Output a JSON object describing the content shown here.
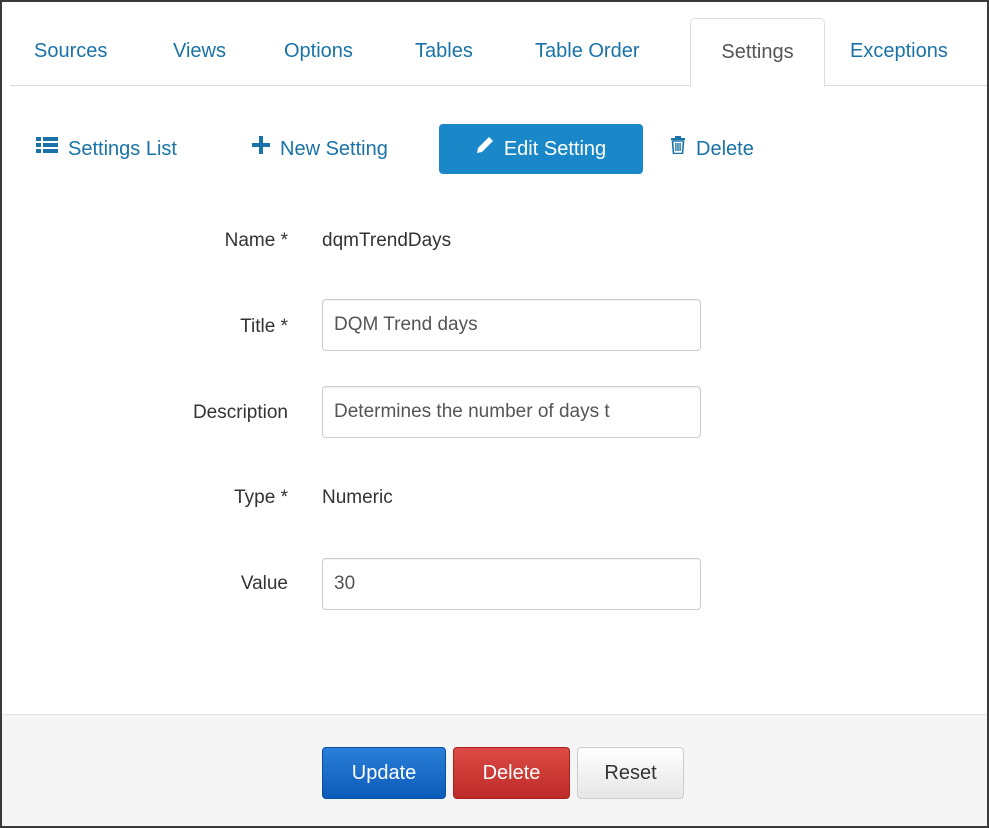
{
  "tabs": [
    {
      "label": "Sources"
    },
    {
      "label": "Views"
    },
    {
      "label": "Options"
    },
    {
      "label": "Tables"
    },
    {
      "label": "Table Order"
    },
    {
      "label": "Settings"
    },
    {
      "label": "Exceptions"
    }
  ],
  "active_tab": "Settings",
  "toolbar": {
    "settings_list": {
      "label": "Settings List",
      "icon": "list-icon"
    },
    "new_setting": {
      "label": "New Setting",
      "icon": "plus-icon"
    },
    "edit_setting": {
      "label": "Edit Setting",
      "icon": "pencil-icon"
    },
    "delete": {
      "label": "Delete",
      "icon": "trash-icon"
    }
  },
  "form": {
    "name": {
      "label": "Name *",
      "value": "dqmTrendDays"
    },
    "title": {
      "label": "Title *",
      "value": "DQM Trend days"
    },
    "description": {
      "label": "Description",
      "value": "Determines the number of days t"
    },
    "type": {
      "label": "Type *",
      "value": "Numeric"
    },
    "value": {
      "label": "Value",
      "value": "30"
    }
  },
  "footer": {
    "update_label": "Update",
    "delete_label": "Delete",
    "reset_label": "Reset"
  },
  "colors": {
    "link": "#1a73a8",
    "primary": "#1a88c8",
    "update": "#0b5bb8",
    "danger": "#bd2c28"
  }
}
